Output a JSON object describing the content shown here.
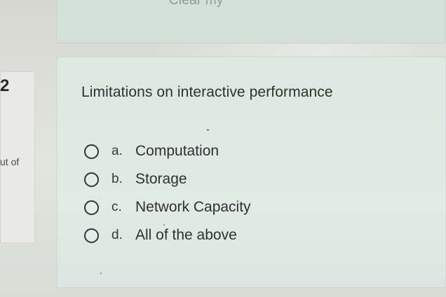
{
  "previous_card": {
    "partial_text": "Clear my"
  },
  "question_info": {
    "number": "2",
    "points_text": "ut of"
  },
  "question": {
    "text": "Limitations on interactive performance",
    "options": [
      {
        "letter": "a.",
        "label": "Computation"
      },
      {
        "letter": "b.",
        "label": "Storage"
      },
      {
        "letter": "c.",
        "label": "Network Capacity"
      },
      {
        "letter": "d.",
        "label": "All of the above"
      }
    ]
  },
  "colors": {
    "card_background": "#dde8e3",
    "text": "#2e312f"
  }
}
